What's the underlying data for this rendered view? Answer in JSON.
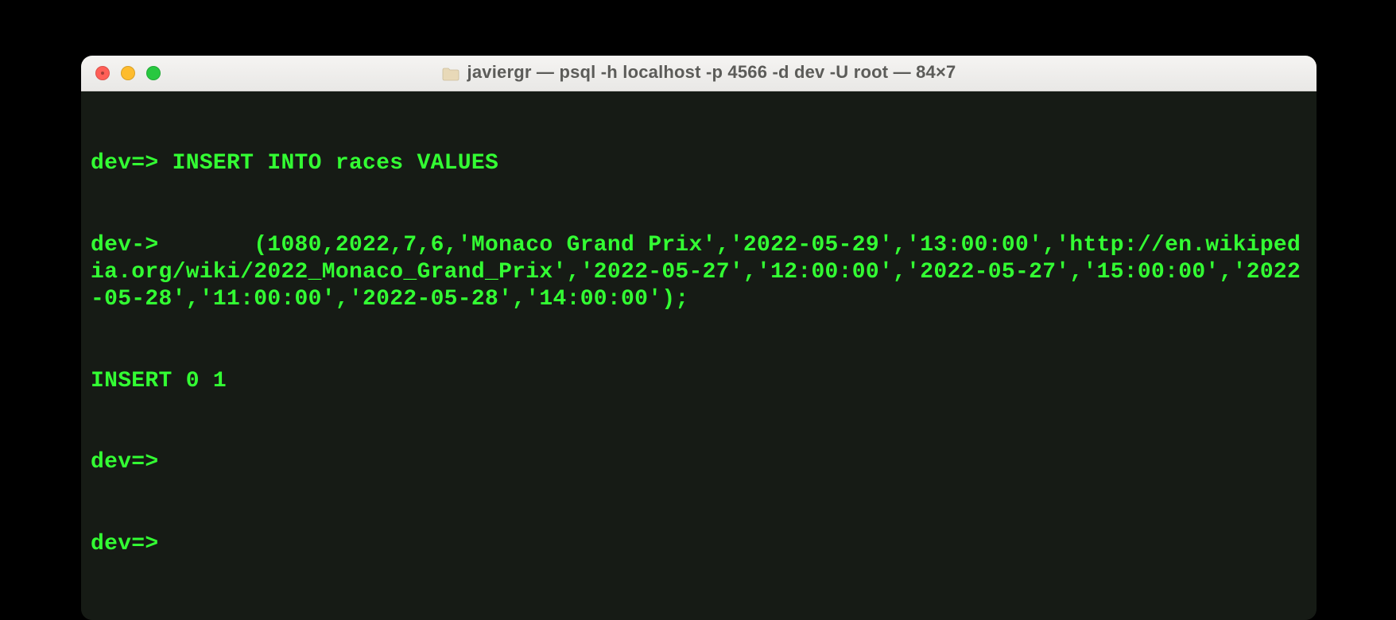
{
  "window": {
    "title": "javiergr — psql -h localhost -p 4566 -d dev -U root — 84×7",
    "traffic": {
      "red": true,
      "yellow": true,
      "green": true
    }
  },
  "terminal": {
    "lines": [
      "dev=> INSERT INTO races VALUES",
      "dev->       (1080,2022,7,6,'Monaco Grand Prix','2022-05-29','13:00:00','http://en.wikipedia.org/wiki/2022_Monaco_Grand_Prix','2022-05-27','12:00:00','2022-05-27','15:00:00','2022-05-28','11:00:00','2022-05-28','14:00:00');",
      "INSERT 0 1",
      "dev=>",
      "dev=>"
    ]
  },
  "colors": {
    "window_bg": "#161b15",
    "fg": "#33ff33",
    "titlebar_text": "#5c5c59"
  }
}
